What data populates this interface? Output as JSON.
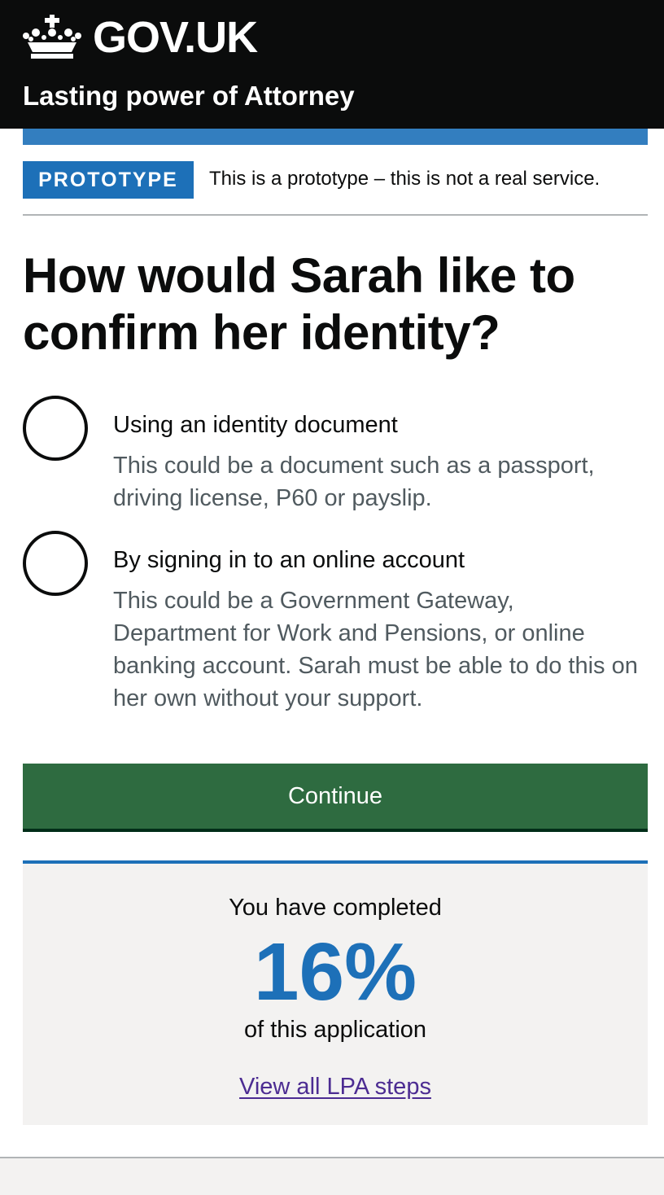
{
  "header": {
    "logo_text": "GOV.UK",
    "service_name": "Lasting power of Attorney",
    "logo_icon": "crown-icon"
  },
  "phase_banner": {
    "tag": "PROTOTYPE",
    "text": "This is a prototype – this is not a real service."
  },
  "question": {
    "heading": "How would Sarah like to confirm her identity?"
  },
  "options": [
    {
      "label": "Using an identity document",
      "hint": "This could be a document such as a passport, driving license, P60 or payslip.",
      "selected": false
    },
    {
      "label": "By signing in to an online account",
      "hint": "This could be a Government Gateway, Department for Work and Pensions, or online banking account. Sarah must be able to do this on her own without your support.",
      "selected": false
    }
  ],
  "continue_button": {
    "label": "Continue"
  },
  "progress": {
    "top_text": "You have completed",
    "percent": "16%",
    "bottom_text": "of this application",
    "link_text": "View all LPA steps"
  },
  "colors": {
    "header_bg": "#0b0c0c",
    "brand_blue": "#1d70b8",
    "button_green": "#2e6b40",
    "link_purple": "#4c2c92",
    "hint_grey": "#505a5f",
    "panel_grey": "#f3f2f1"
  }
}
